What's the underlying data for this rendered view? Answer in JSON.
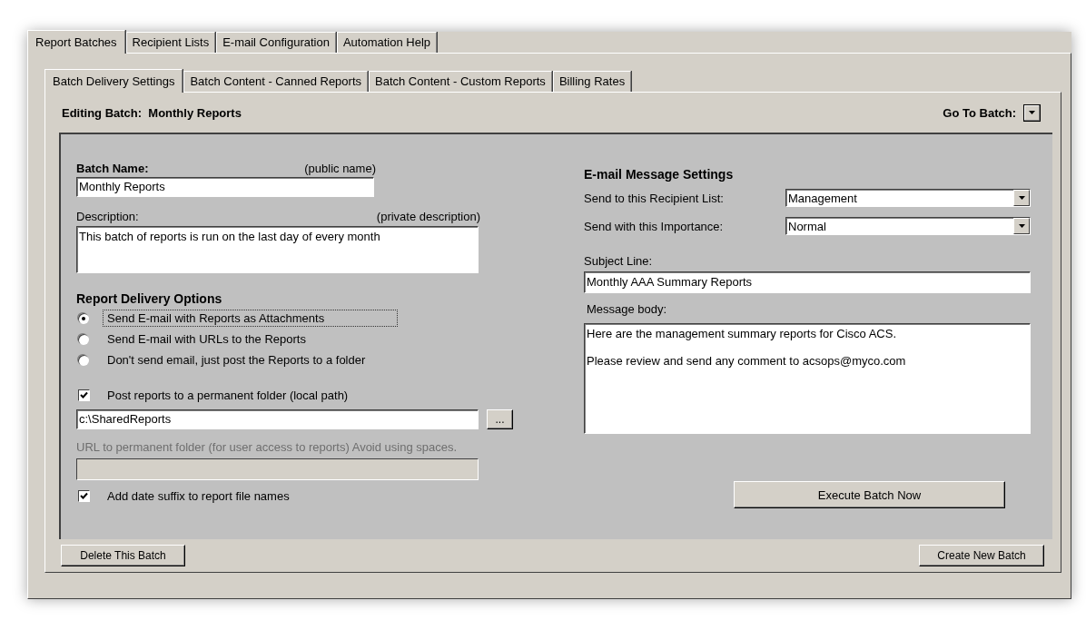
{
  "window_tabs": [
    {
      "label": "Report Batches",
      "selected": true
    },
    {
      "label": "Recipient Lists",
      "selected": false
    },
    {
      "label": "E-mail Configuration",
      "selected": false
    },
    {
      "label": "Automation Help",
      "selected": false
    }
  ],
  "sub_tabs": [
    {
      "label": "Batch Delivery Settings",
      "selected": true
    },
    {
      "label": "Batch Content - Canned Reports",
      "selected": false
    },
    {
      "label": "Batch Content - Custom Reports",
      "selected": false
    },
    {
      "label": "Billing Rates",
      "selected": false
    }
  ],
  "editing": {
    "label": "Editing Batch:",
    "value": "Monthly Reports"
  },
  "go_to": {
    "label": "Go To Batch:"
  },
  "batch_name": {
    "label": "Batch Name:",
    "hint": "(public name)",
    "value": "Monthly Reports"
  },
  "description": {
    "label": "Description:",
    "hint": "(private description)",
    "value": "This batch of reports is run on the last day of every month"
  },
  "delivery": {
    "title": "Report Delivery Options",
    "options": [
      {
        "label": "Send E-mail with Reports as Attachments",
        "selected": true,
        "focused": true
      },
      {
        "label": "Send E-mail with URLs to the Reports",
        "selected": false,
        "focused": false
      },
      {
        "label": "Don't send email, just post the Reports to a folder",
        "selected": false,
        "focused": false
      }
    ]
  },
  "post_folder": {
    "label": "Post reports to a permanent folder (local path)",
    "checked": true,
    "path": "c:\\SharedReports",
    "browse": "..."
  },
  "url_folder": {
    "label": "URL to permanent folder (for user access to reports) Avoid using spaces.",
    "disabled": true
  },
  "date_suffix": {
    "label": "Add date suffix to report file names",
    "checked": true
  },
  "email": {
    "title": "E-mail Message Settings",
    "recipient_list": {
      "label": "Send to this Recipient List:",
      "value": "Management"
    },
    "importance": {
      "label": "Send with this Importance:",
      "value": "Normal"
    },
    "subject": {
      "label": "Subject Line:",
      "value": "Monthly AAA Summary Reports"
    },
    "body": {
      "label": "Message body:",
      "value": "Here are the management summary reports for Cisco ACS.\n\nPlease review and send any comment to acsops@myco.com"
    }
  },
  "execute_button": "Execute Batch Now",
  "delete_button": "Delete This Batch",
  "create_button": "Create New Batch"
}
